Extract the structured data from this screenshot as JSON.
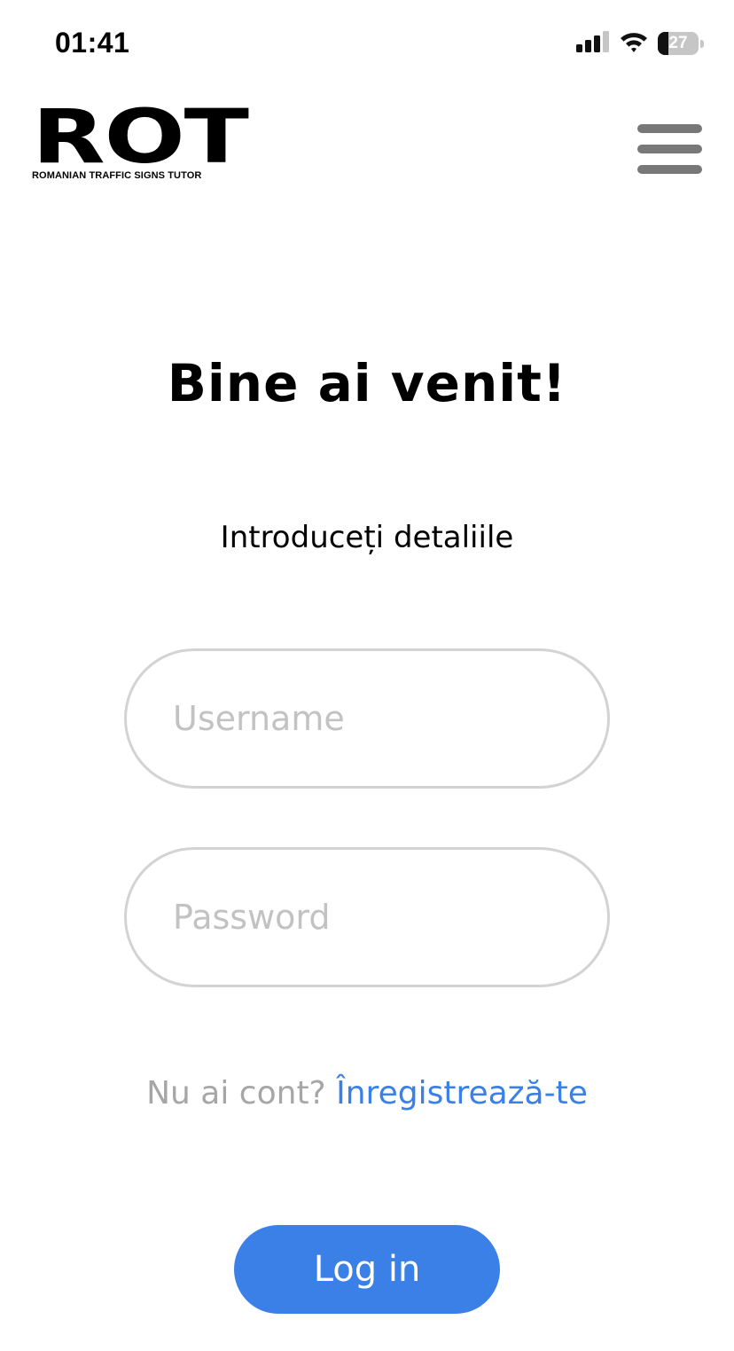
{
  "status_bar": {
    "time": "01:41",
    "battery": "27",
    "battery_level": 0.27,
    "icons": [
      "signal-icon",
      "wifi-icon",
      "battery-icon"
    ]
  },
  "header": {
    "logo_text": "ROT",
    "logo_subtitle": "ROMANIAN TRAFFIC SIGNS TUTOR",
    "menu_icon": "hamburger-menu-icon"
  },
  "main": {
    "title": "Bine ai venit!",
    "subtitle": "Introduceți detaliile",
    "username_placeholder": "Username",
    "password_placeholder": "Password",
    "signup_prompt": "Nu ai cont?",
    "signup_link": "Înregistrează-te",
    "login_label": "Log in"
  },
  "colors": {
    "accent": "#3a80e6",
    "field_border": "#d3d3d3",
    "placeholder": "#c2c2c2",
    "muted_text": "#a6a6a6",
    "menu_icon": "#787878"
  }
}
